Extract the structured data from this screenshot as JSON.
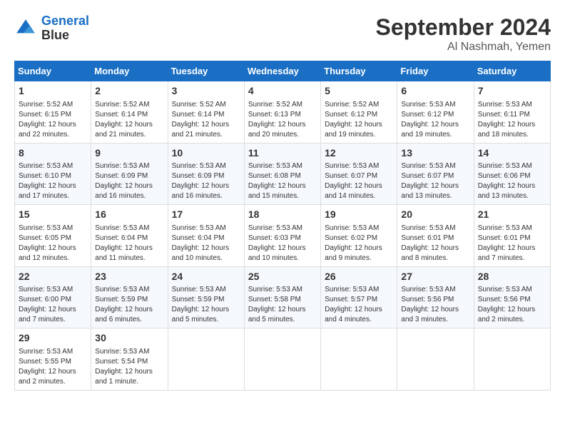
{
  "logo": {
    "line1": "General",
    "line2": "Blue"
  },
  "title": "September 2024",
  "subtitle": "Al Nashmah, Yemen",
  "headers": [
    "Sunday",
    "Monday",
    "Tuesday",
    "Wednesday",
    "Thursday",
    "Friday",
    "Saturday"
  ],
  "weeks": [
    [
      {
        "day": "1",
        "info": "Sunrise: 5:52 AM\nSunset: 6:15 PM\nDaylight: 12 hours\nand 22 minutes."
      },
      {
        "day": "2",
        "info": "Sunrise: 5:52 AM\nSunset: 6:14 PM\nDaylight: 12 hours\nand 21 minutes."
      },
      {
        "day": "3",
        "info": "Sunrise: 5:52 AM\nSunset: 6:14 PM\nDaylight: 12 hours\nand 21 minutes."
      },
      {
        "day": "4",
        "info": "Sunrise: 5:52 AM\nSunset: 6:13 PM\nDaylight: 12 hours\nand 20 minutes."
      },
      {
        "day": "5",
        "info": "Sunrise: 5:52 AM\nSunset: 6:12 PM\nDaylight: 12 hours\nand 19 minutes."
      },
      {
        "day": "6",
        "info": "Sunrise: 5:53 AM\nSunset: 6:12 PM\nDaylight: 12 hours\nand 19 minutes."
      },
      {
        "day": "7",
        "info": "Sunrise: 5:53 AM\nSunset: 6:11 PM\nDaylight: 12 hours\nand 18 minutes."
      }
    ],
    [
      {
        "day": "8",
        "info": "Sunrise: 5:53 AM\nSunset: 6:10 PM\nDaylight: 12 hours\nand 17 minutes."
      },
      {
        "day": "9",
        "info": "Sunrise: 5:53 AM\nSunset: 6:09 PM\nDaylight: 12 hours\nand 16 minutes."
      },
      {
        "day": "10",
        "info": "Sunrise: 5:53 AM\nSunset: 6:09 PM\nDaylight: 12 hours\nand 16 minutes."
      },
      {
        "day": "11",
        "info": "Sunrise: 5:53 AM\nSunset: 6:08 PM\nDaylight: 12 hours\nand 15 minutes."
      },
      {
        "day": "12",
        "info": "Sunrise: 5:53 AM\nSunset: 6:07 PM\nDaylight: 12 hours\nand 14 minutes."
      },
      {
        "day": "13",
        "info": "Sunrise: 5:53 AM\nSunset: 6:07 PM\nDaylight: 12 hours\nand 13 minutes."
      },
      {
        "day": "14",
        "info": "Sunrise: 5:53 AM\nSunset: 6:06 PM\nDaylight: 12 hours\nand 13 minutes."
      }
    ],
    [
      {
        "day": "15",
        "info": "Sunrise: 5:53 AM\nSunset: 6:05 PM\nDaylight: 12 hours\nand 12 minutes."
      },
      {
        "day": "16",
        "info": "Sunrise: 5:53 AM\nSunset: 6:04 PM\nDaylight: 12 hours\nand 11 minutes."
      },
      {
        "day": "17",
        "info": "Sunrise: 5:53 AM\nSunset: 6:04 PM\nDaylight: 12 hours\nand 10 minutes."
      },
      {
        "day": "18",
        "info": "Sunrise: 5:53 AM\nSunset: 6:03 PM\nDaylight: 12 hours\nand 10 minutes."
      },
      {
        "day": "19",
        "info": "Sunrise: 5:53 AM\nSunset: 6:02 PM\nDaylight: 12 hours\nand 9 minutes."
      },
      {
        "day": "20",
        "info": "Sunrise: 5:53 AM\nSunset: 6:01 PM\nDaylight: 12 hours\nand 8 minutes."
      },
      {
        "day": "21",
        "info": "Sunrise: 5:53 AM\nSunset: 6:01 PM\nDaylight: 12 hours\nand 7 minutes."
      }
    ],
    [
      {
        "day": "22",
        "info": "Sunrise: 5:53 AM\nSunset: 6:00 PM\nDaylight: 12 hours\nand 7 minutes."
      },
      {
        "day": "23",
        "info": "Sunrise: 5:53 AM\nSunset: 5:59 PM\nDaylight: 12 hours\nand 6 minutes."
      },
      {
        "day": "24",
        "info": "Sunrise: 5:53 AM\nSunset: 5:59 PM\nDaylight: 12 hours\nand 5 minutes."
      },
      {
        "day": "25",
        "info": "Sunrise: 5:53 AM\nSunset: 5:58 PM\nDaylight: 12 hours\nand 5 minutes."
      },
      {
        "day": "26",
        "info": "Sunrise: 5:53 AM\nSunset: 5:57 PM\nDaylight: 12 hours\nand 4 minutes."
      },
      {
        "day": "27",
        "info": "Sunrise: 5:53 AM\nSunset: 5:56 PM\nDaylight: 12 hours\nand 3 minutes."
      },
      {
        "day": "28",
        "info": "Sunrise: 5:53 AM\nSunset: 5:56 PM\nDaylight: 12 hours\nand 2 minutes."
      }
    ],
    [
      {
        "day": "29",
        "info": "Sunrise: 5:53 AM\nSunset: 5:55 PM\nDaylight: 12 hours\nand 2 minutes."
      },
      {
        "day": "30",
        "info": "Sunrise: 5:53 AM\nSunset: 5:54 PM\nDaylight: 12 hours\nand 1 minute."
      },
      {
        "day": "",
        "info": ""
      },
      {
        "day": "",
        "info": ""
      },
      {
        "day": "",
        "info": ""
      },
      {
        "day": "",
        "info": ""
      },
      {
        "day": "",
        "info": ""
      }
    ]
  ]
}
